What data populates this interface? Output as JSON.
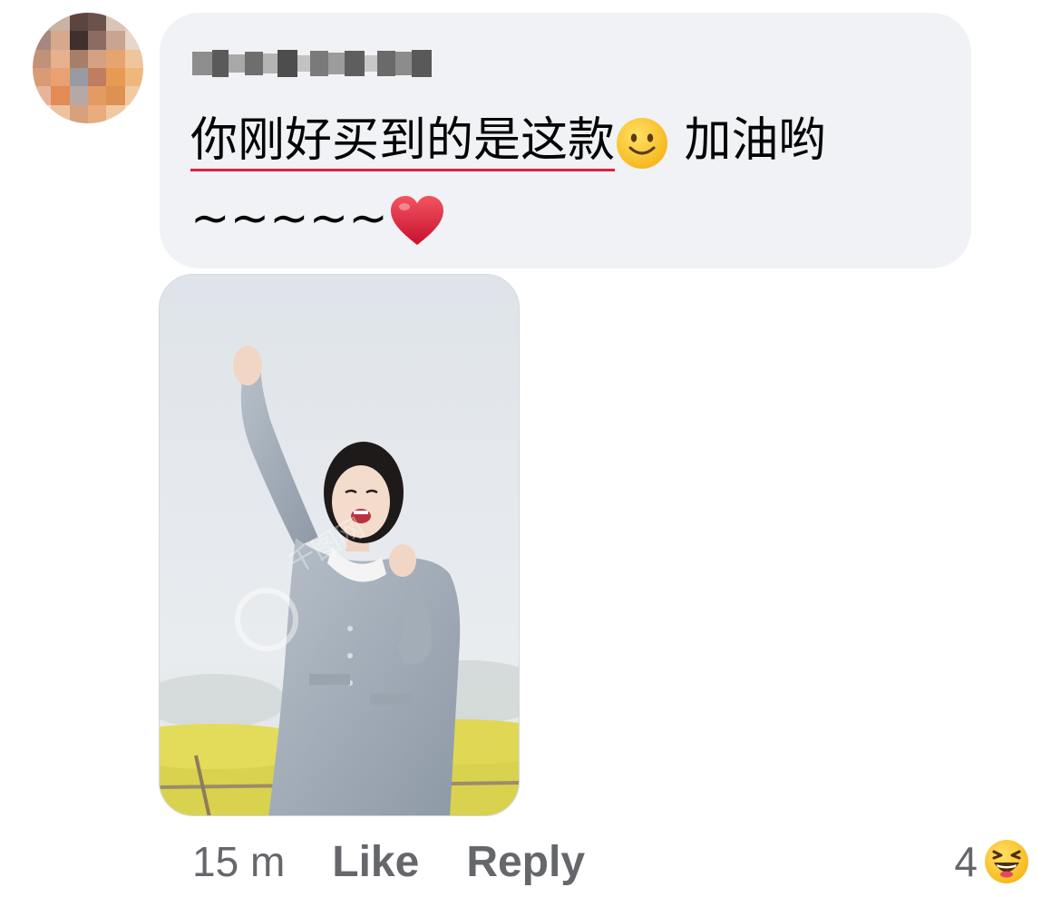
{
  "comment": {
    "author_name": "",
    "text_underlined": "你刚好买到的是这款",
    "text_after_smile": " 加油哟",
    "text_line2": "~~~~~",
    "emojis": [
      "slightly-smiling-face-icon",
      "red-heart-icon"
    ]
  },
  "attachment": {
    "type": "photo",
    "watermark": "千图网"
  },
  "meta": {
    "timestamp": "15 m",
    "like_label": "Like",
    "reply_label": "Reply",
    "reaction_count": "4",
    "reaction_icon": "laughing-face-icon"
  },
  "colors": {
    "bubble_bg": "#f0f2f5",
    "secondary_text": "#65676b",
    "spellcheck_underline": "#e41e3f"
  }
}
